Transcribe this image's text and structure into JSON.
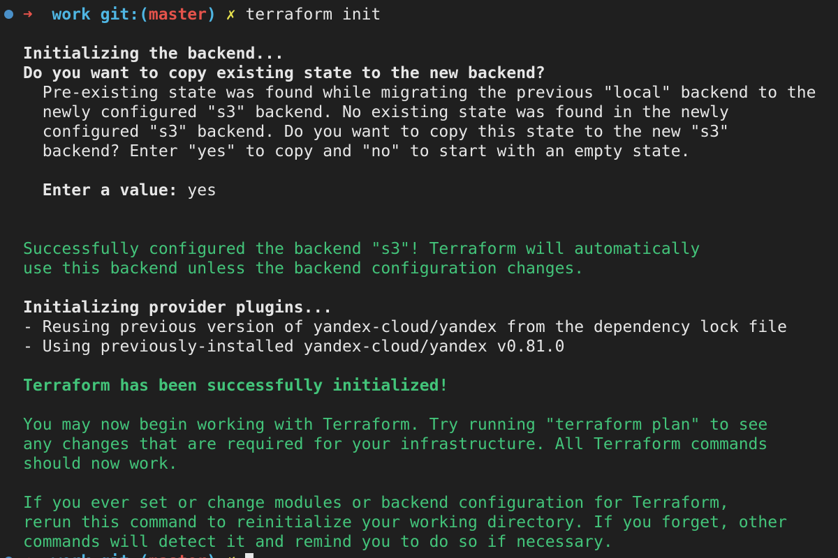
{
  "colors": {
    "background": "#1f1f1f",
    "text": "#e6e6e6",
    "success_green": "#43c47a",
    "prompt_cyan": "#4fb6e3",
    "prompt_red": "#e5534b",
    "prompt_yellow": "#e8e24e",
    "status_dot": "#4a90c8"
  },
  "prompt": {
    "status_dot_icon": "status-dot-icon",
    "arrow": "➜",
    "directory": "work",
    "git_label": "git:",
    "open_paren": "(",
    "branch": "master",
    "close_paren": ")",
    "dirty_mark": "✗",
    "command": "terraform init"
  },
  "output": {
    "backend_heading": "Initializing the backend...",
    "copy_question": "Do you want to copy existing state to the new backend?",
    "copy_description": [
      "  Pre-existing state was found while migrating the previous \"local\" backend to the",
      "  newly configured \"s3\" backend. No existing state was found in the newly",
      "  configured \"s3\" backend. Do you want to copy this state to the new \"s3\"",
      "  backend? Enter \"yes\" to copy and \"no\" to start with an empty state."
    ],
    "enter_value_label": "  Enter a value:",
    "enter_value_answer": " yes",
    "backend_success": [
      "Successfully configured the backend \"s3\"! Terraform will automatically",
      "use this backend unless the backend configuration changes."
    ],
    "provider_heading": "Initializing provider plugins...",
    "provider_lines": [
      "- Reusing previous version of yandex-cloud/yandex from the dependency lock file",
      "- Using previously-installed yandex-cloud/yandex v0.81.0"
    ],
    "init_success": "Terraform has been successfully initialized!",
    "next_steps": [
      "You may now begin working with Terraform. Try running \"terraform plan\" to see",
      "any changes that are required for your infrastructure. All Terraform commands",
      "should now work."
    ],
    "reinit_note": [
      "If you ever set or change modules or backend configuration for Terraform,",
      "rerun this command to reinitialize your working directory. If you forget, other",
      "commands will detect it and remind you to do so if necessary."
    ]
  },
  "next_prompt": {
    "arrow": "➜",
    "directory": "work",
    "git_label": "git:",
    "open_paren": "(",
    "branch": "master",
    "close_paren": ")",
    "dirty_mark": "✗",
    "cursor_icon": "cursor-block-icon"
  }
}
